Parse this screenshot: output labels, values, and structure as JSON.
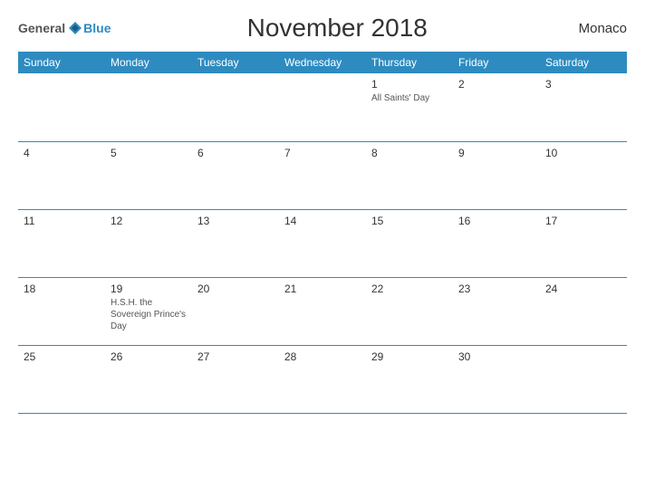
{
  "logo": {
    "general": "General",
    "blue": "Blue"
  },
  "title": "November 2018",
  "country": "Monaco",
  "days_header": [
    "Sunday",
    "Monday",
    "Tuesday",
    "Wednesday",
    "Thursday",
    "Friday",
    "Saturday"
  ],
  "weeks": [
    [
      {
        "day": "",
        "event": ""
      },
      {
        "day": "",
        "event": ""
      },
      {
        "day": "",
        "event": ""
      },
      {
        "day": "",
        "event": ""
      },
      {
        "day": "1",
        "event": "All Saints' Day"
      },
      {
        "day": "2",
        "event": ""
      },
      {
        "day": "3",
        "event": ""
      }
    ],
    [
      {
        "day": "4",
        "event": ""
      },
      {
        "day": "5",
        "event": ""
      },
      {
        "day": "6",
        "event": ""
      },
      {
        "day": "7",
        "event": ""
      },
      {
        "day": "8",
        "event": ""
      },
      {
        "day": "9",
        "event": ""
      },
      {
        "day": "10",
        "event": ""
      }
    ],
    [
      {
        "day": "11",
        "event": ""
      },
      {
        "day": "12",
        "event": ""
      },
      {
        "day": "13",
        "event": ""
      },
      {
        "day": "14",
        "event": ""
      },
      {
        "day": "15",
        "event": ""
      },
      {
        "day": "16",
        "event": ""
      },
      {
        "day": "17",
        "event": ""
      }
    ],
    [
      {
        "day": "18",
        "event": ""
      },
      {
        "day": "19",
        "event": "H.S.H. the Sovereign Prince's Day"
      },
      {
        "day": "20",
        "event": ""
      },
      {
        "day": "21",
        "event": ""
      },
      {
        "day": "22",
        "event": ""
      },
      {
        "day": "23",
        "event": ""
      },
      {
        "day": "24",
        "event": ""
      }
    ],
    [
      {
        "day": "25",
        "event": ""
      },
      {
        "day": "26",
        "event": ""
      },
      {
        "day": "27",
        "event": ""
      },
      {
        "day": "28",
        "event": ""
      },
      {
        "day": "29",
        "event": ""
      },
      {
        "day": "30",
        "event": ""
      },
      {
        "day": "",
        "event": ""
      }
    ]
  ]
}
